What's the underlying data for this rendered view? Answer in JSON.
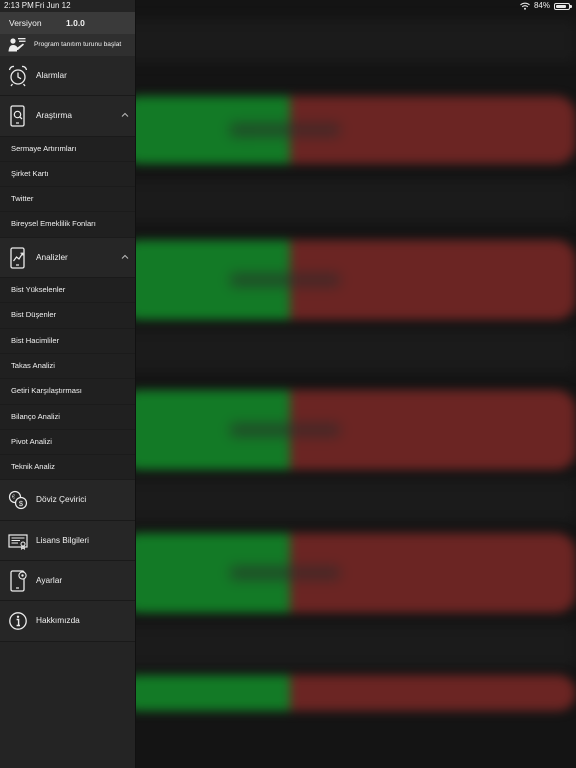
{
  "status_bar": {
    "time": "2:13 PM",
    "date": "Fri Jun 12",
    "battery": "84%",
    "battery_level": 0.84
  },
  "drawer": {
    "version_label": "Versiyon",
    "version_value": "1.0.0",
    "tour_label": "Program tanıtım turunu başlat",
    "items": [
      {
        "label": "Alarmlar",
        "icon": "alarm-clock-icon"
      },
      {
        "label": "Araştırma",
        "icon": "phone-search-icon",
        "expanded": true,
        "children": [
          "Sermaye Artırımları",
          "Şirket Kartı",
          "Twitter",
          "Bireysel Emeklilik Fonları"
        ]
      },
      {
        "label": "Analizler",
        "icon": "phone-chart-icon",
        "expanded": true,
        "children": [
          "Bist Yükselenler",
          "Bist Düşenler",
          "Bist Hacimliler",
          "Takas Analizi",
          "Getiri Karşılaştırması",
          "Bilanço Analizi",
          "Pivot Analizi",
          "Teknik Analiz"
        ]
      },
      {
        "label": "Döviz Çevirici",
        "icon": "currency-exchange-icon"
      },
      {
        "label": "Lisans Bilgileri",
        "icon": "certificate-icon"
      },
      {
        "label": "Ayarlar",
        "icon": "phone-settings-icon"
      },
      {
        "label": "Hakkımızda",
        "icon": "info-icon"
      }
    ]
  },
  "colors": {
    "drawer_bg": "#242424",
    "version_bg": "#3a3a3a",
    "bar_green": "#137a26",
    "bar_red": "#6b2523"
  }
}
